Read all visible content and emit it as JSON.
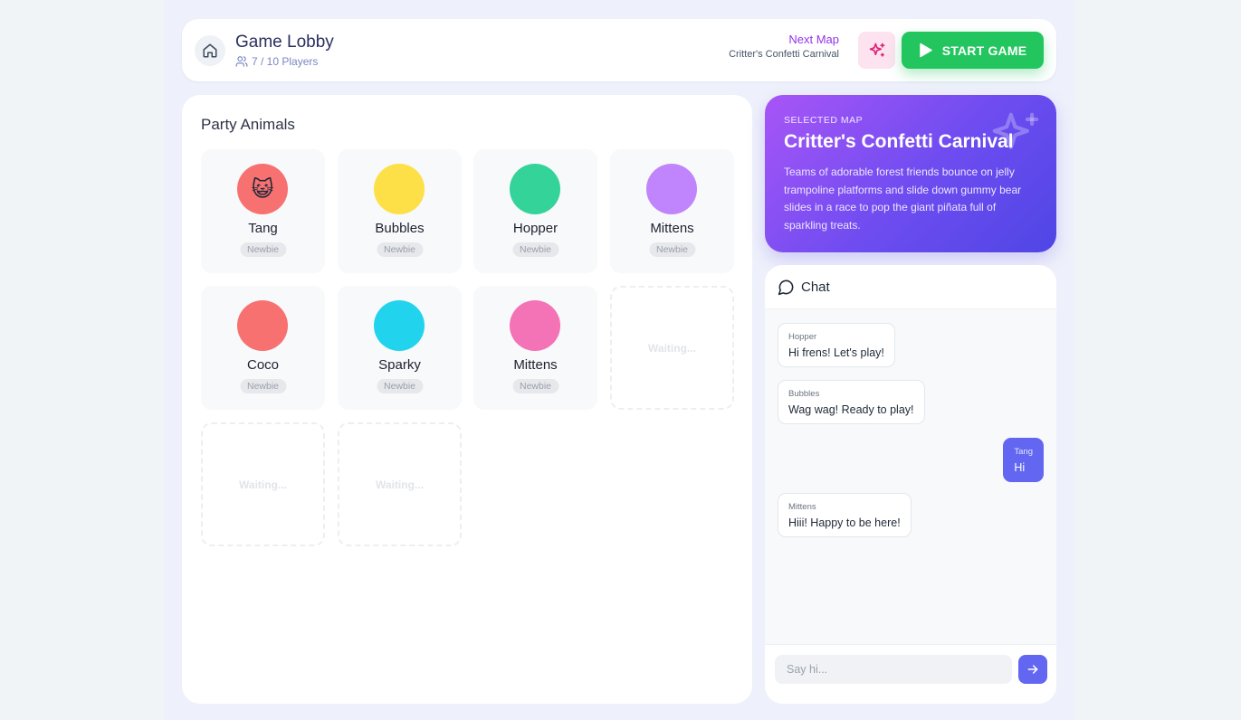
{
  "header": {
    "title": "Game Lobby",
    "player_count": "7 / 10 Players",
    "next_map_label": "Next Map",
    "next_map_value": "Critter's Confetti Carnival",
    "start_label": "START GAME",
    "icons": [
      "home-icon",
      "users-icon",
      "sparkles-icon",
      "play-icon"
    ]
  },
  "team": {
    "title": "Party Animals",
    "players": [
      {
        "name": "Tang",
        "rank": "Newbie",
        "color": "#f87171",
        "emoji": "😺"
      },
      {
        "name": "Bubbles",
        "rank": "Newbie",
        "color": "#fde047",
        "emoji": ""
      },
      {
        "name": "Hopper",
        "rank": "Newbie",
        "color": "#34d399",
        "emoji": ""
      },
      {
        "name": "Mittens",
        "rank": "Newbie",
        "color": "#c084fc",
        "emoji": ""
      },
      {
        "name": "Coco",
        "rank": "Newbie",
        "color": "#f87171",
        "emoji": ""
      },
      {
        "name": "Sparky",
        "rank": "Newbie",
        "color": "#22d3ee",
        "emoji": ""
      },
      {
        "name": "Mittens",
        "rank": "Newbie",
        "color": "#f472b6",
        "emoji": ""
      }
    ],
    "empty_label": "Waiting..."
  },
  "map": {
    "section_label": "SELECTED MAP",
    "name": "Critter's Confetti Carnival",
    "description": "Teams of adorable forest friends bounce on jelly trampoline platforms and slide down gummy bear slides in a race to pop the giant piñata full of sparkling treats.",
    "gradient": [
      "#a855f7",
      "#4f46e5"
    ]
  },
  "chat": {
    "title": "Chat",
    "messages": [
      {
        "author": "Hopper",
        "text": "Hi frens! Let's play!",
        "mine": false
      },
      {
        "author": "Bubbles",
        "text": "Wag wag! Ready to play!",
        "mine": false
      },
      {
        "author": "Tang",
        "text": "Hi",
        "mine": true
      },
      {
        "author": "Mittens",
        "text": "Hiii! Happy to be here!",
        "mine": false
      }
    ],
    "input_placeholder": "Say hi..."
  },
  "colors": {
    "accent": "#6366f1",
    "start": "#22c55e",
    "next_map": "#9333ea"
  }
}
